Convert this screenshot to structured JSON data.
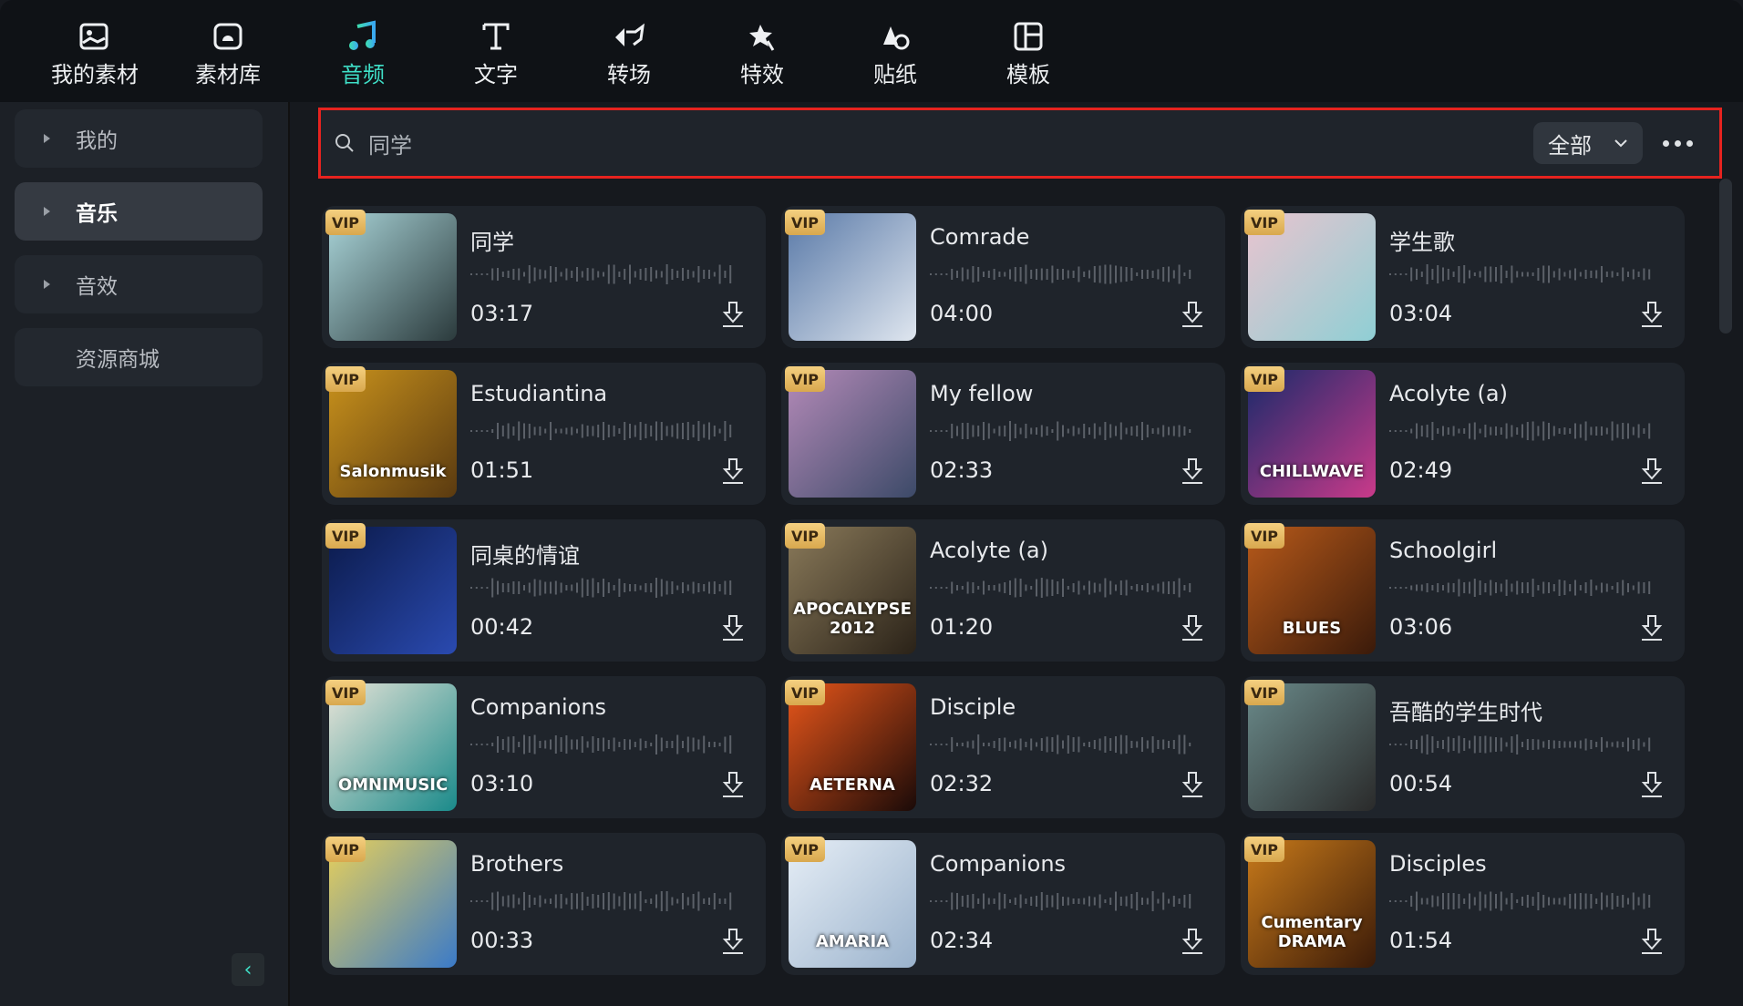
{
  "tabs": [
    {
      "label": "我的素材",
      "icon": "image-icon"
    },
    {
      "label": "素材库",
      "icon": "folder-icon"
    },
    {
      "label": "音频",
      "icon": "music-note-icon",
      "active": true
    },
    {
      "label": "文字",
      "icon": "text-icon"
    },
    {
      "label": "转场",
      "icon": "transition-icon"
    },
    {
      "label": "特效",
      "icon": "effects-star-icon"
    },
    {
      "label": "贴纸",
      "icon": "sticker-icon"
    },
    {
      "label": "模板",
      "icon": "template-icon"
    }
  ],
  "sidebar": {
    "items": [
      {
        "label": "我的",
        "expandable": true
      },
      {
        "label": "音乐",
        "expandable": true,
        "active": true
      },
      {
        "label": "音效",
        "expandable": true
      },
      {
        "label": "资源商城",
        "expandable": false
      }
    ]
  },
  "search": {
    "value": "同学",
    "filter": "全部"
  },
  "colors": {
    "accent": "#3fe0c8",
    "highlight_border": "#e6231f",
    "vip": "#e8bc66"
  },
  "badge": "VIP",
  "tracks": [
    {
      "title": "同学",
      "duration": "03:17",
      "cover": [
        "#a9d4d8",
        "#2b3a3c"
      ],
      "cover_text": ""
    },
    {
      "title": "Comrade",
      "duration": "04:00",
      "cover": [
        "#5a7aa8",
        "#dfe6ef"
      ],
      "cover_text": ""
    },
    {
      "title": "学生歌",
      "duration": "03:04",
      "cover": [
        "#e9c4cf",
        "#8fcfd4"
      ],
      "cover_text": ""
    },
    {
      "title": "Estudiantina",
      "duration": "01:51",
      "cover": [
        "#c9921c",
        "#5a3a10"
      ],
      "cover_text": "Salonmusik"
    },
    {
      "title": "My fellow",
      "duration": "02:33",
      "cover": [
        "#b48ab8",
        "#3c4a68"
      ],
      "cover_text": ""
    },
    {
      "title": "Acolyte (a)",
      "duration": "02:49",
      "cover": [
        "#1a2a6a",
        "#c93a8a"
      ],
      "cover_text": "CHILLWAVE"
    },
    {
      "title": "同桌的情谊",
      "duration": "00:42",
      "cover": [
        "#0b1a4a",
        "#2a4ab0"
      ],
      "cover_text": ""
    },
    {
      "title": "Acolyte (a)",
      "duration": "01:20",
      "cover": [
        "#8a7a5a",
        "#2a2218"
      ],
      "cover_text": "APOCALYPSE 2012"
    },
    {
      "title": "Schoolgirl",
      "duration": "03:06",
      "cover": [
        "#b85a1a",
        "#3a1a0a"
      ],
      "cover_text": "BLUES"
    },
    {
      "title": "Companions",
      "duration": "03:10",
      "cover": [
        "#e8e4d8",
        "#1a8a8a"
      ],
      "cover_text": "OMNIMUSIC"
    },
    {
      "title": "Disciple",
      "duration": "02:32",
      "cover": [
        "#e8561a",
        "#1a0a08"
      ],
      "cover_text": "AETERNA"
    },
    {
      "title": "吾酷的学生时代",
      "duration": "00:54",
      "cover": [
        "#6a8a8a",
        "#2a2a2a"
      ],
      "cover_text": ""
    },
    {
      "title": "Brothers",
      "duration": "00:33",
      "cover": [
        "#e8d05a",
        "#3a7ac8"
      ],
      "cover_text": ""
    },
    {
      "title": "Companions",
      "duration": "02:34",
      "cover": [
        "#e6eef6",
        "#9ab2cc"
      ],
      "cover_text": "AMARIA"
    },
    {
      "title": "Disciples",
      "duration": "01:54",
      "cover": [
        "#c87a1a",
        "#3a1a08"
      ],
      "cover_text": "Cumentary DRAMA"
    }
  ]
}
